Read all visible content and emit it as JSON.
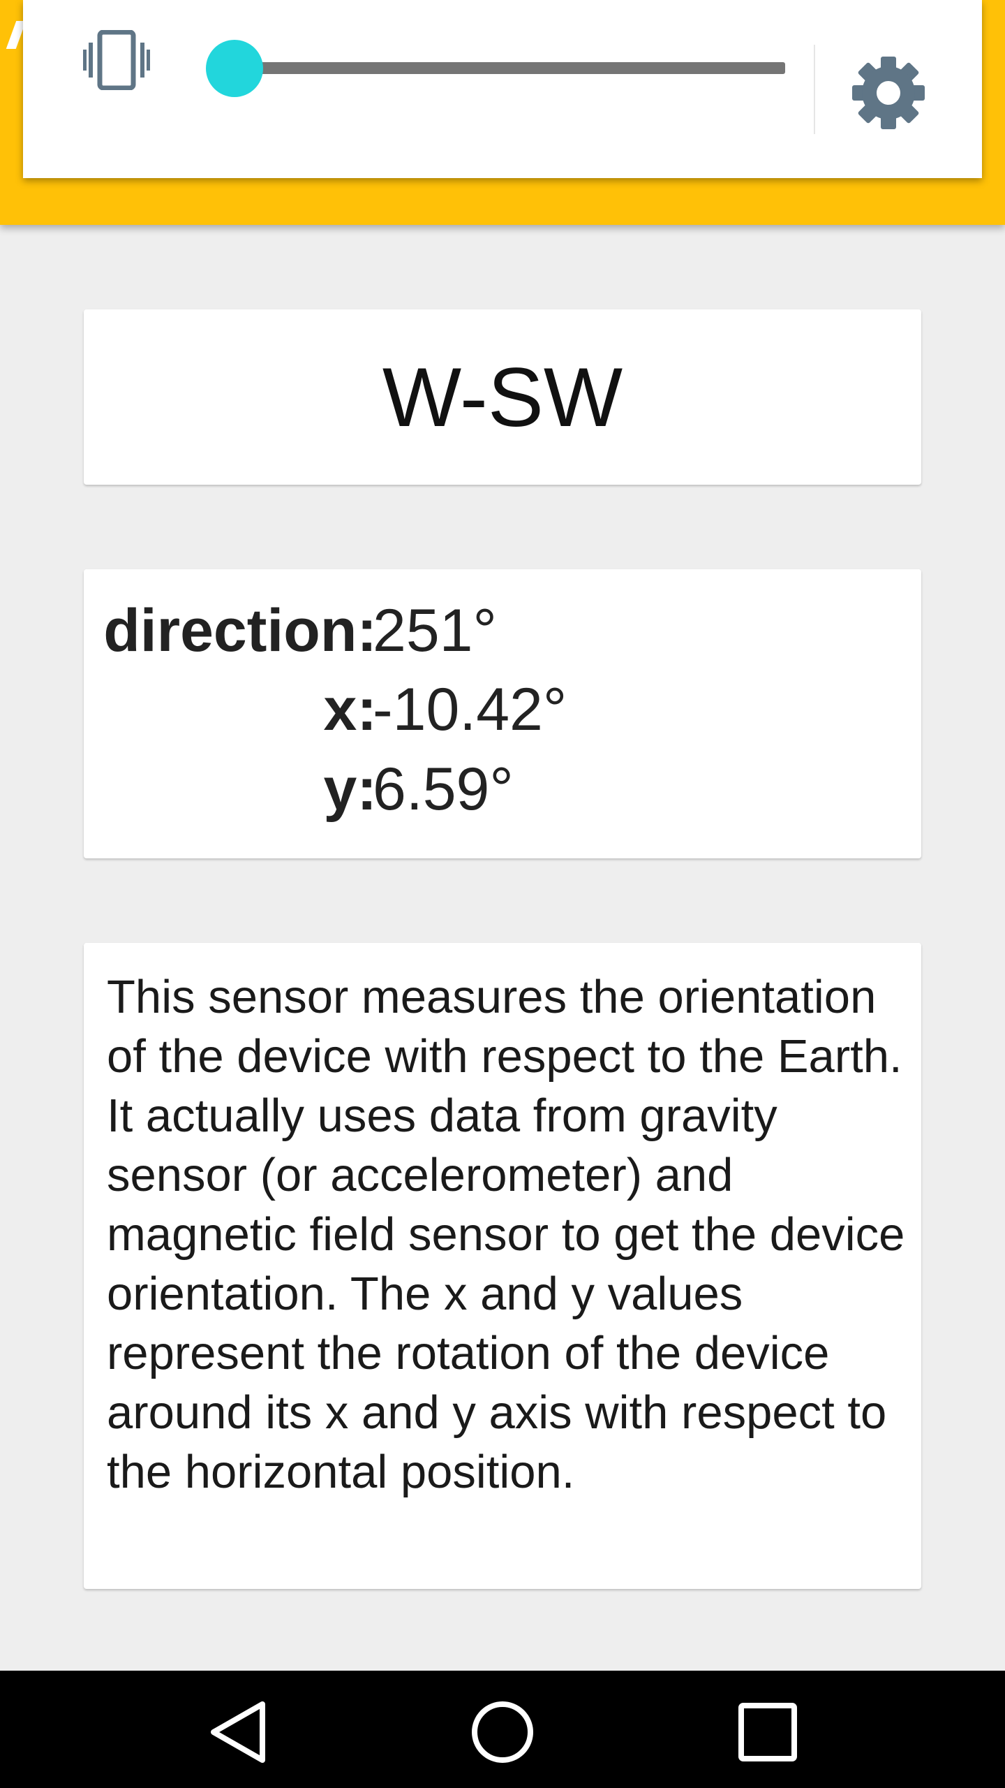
{
  "toolbar_popup": {
    "vibrate_icon": "vibrate-icon",
    "slider_level": 0,
    "settings_icon": "gear-icon",
    "accent_color": "#22d6dc"
  },
  "appbar": {
    "color": "#ffc107"
  },
  "direction_card": {
    "compass_label": "W-SW"
  },
  "values_card": {
    "direction_label": "direction:",
    "direction_value": "251°",
    "x_label": "x:",
    "x_value": "-10.42°",
    "y_label": "y:",
    "y_value": "6.59°"
  },
  "description_card": {
    "text": "This sensor measures the orientation of the device with respect to the Earth. It actually uses data from gravity sensor (or accelerometer) and magnetic field sensor to get the device orientation. The x and y values represent the rotation of the device around its x and y axis with respect to the horizontal position."
  },
  "navigation_bar": {
    "back_icon": "back-triangle-icon",
    "home_icon": "home-circle-icon",
    "recents_icon": "recents-square-icon"
  }
}
